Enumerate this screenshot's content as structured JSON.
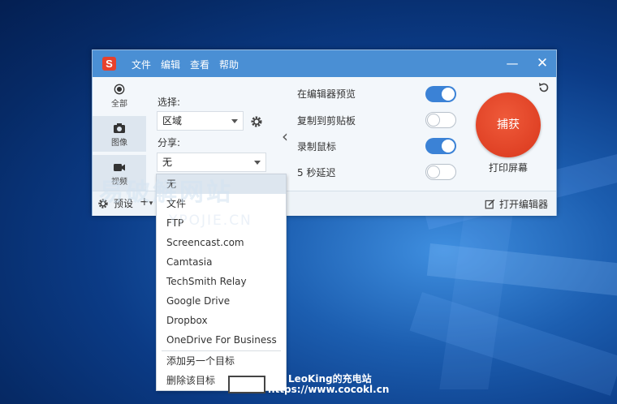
{
  "app": {
    "logo_letter": "S",
    "menu": [
      "文件",
      "编辑",
      "查看",
      "帮助"
    ],
    "minimize_symbol": "—",
    "close_symbol": "✕"
  },
  "tabs": [
    {
      "label": "全部",
      "icon": "target-icon"
    },
    {
      "label": "图像",
      "icon": "camera-icon"
    },
    {
      "label": "视频",
      "icon": "video-camera-icon"
    }
  ],
  "capture_settings": {
    "select_label": "选择:",
    "select_value": "区域",
    "share_label": "分享:",
    "share_value": "无"
  },
  "options": [
    {
      "label": "在编辑器预览",
      "on": true
    },
    {
      "label": "复制到剪贴板",
      "on": false
    },
    {
      "label": "录制鼠标",
      "on": true
    },
    {
      "label": "5 秒延迟",
      "on": false
    }
  ],
  "capture_button": {
    "label": "捕获",
    "sublabel": "打印屏幕",
    "color": "#e0401f"
  },
  "bottom": {
    "preset_label": "预设",
    "add_symbol": "+",
    "open_editor_label": "打开编辑器"
  },
  "dropdown": {
    "items": [
      "无",
      "文件",
      "FTP",
      "Screencast.com",
      "Camtasia",
      "TechSmith Relay",
      "Google Drive",
      "Dropbox",
      "OneDrive For Business"
    ],
    "actions": [
      "添加另一个目标",
      "删除该目标"
    ]
  },
  "watermark": {
    "site_cn": "易破解网站",
    "site_en": "YPOJIE.CN",
    "author": "LeoKing的充电站",
    "url": "https://www.cocokl.cn"
  },
  "colors": {
    "titlebar": "#4a8fd4",
    "toggle_on": "#3b82d6",
    "accent": "#e0401f"
  }
}
